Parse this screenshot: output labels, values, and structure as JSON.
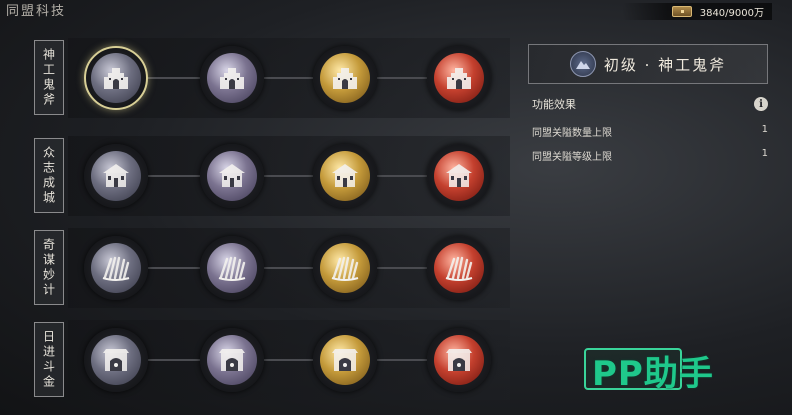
{
  "header": {
    "title": "同盟科技",
    "currency_value": "3840/9000万",
    "currency_icon": "treasure-chest-icon"
  },
  "rows": [
    {
      "label": "神工鬼斧",
      "icon": "fortress-icon"
    },
    {
      "label": "众志成城",
      "icon": "palace-icon"
    },
    {
      "label": "奇谋妙计",
      "icon": "scrolls-icon"
    },
    {
      "label": "日进斗金",
      "icon": "gate-icon"
    }
  ],
  "tiers": [
    "tier1",
    "tier2",
    "tier3",
    "tier4"
  ],
  "selected": {
    "row": 0,
    "tier": 0
  },
  "panel": {
    "title": "初级 · 神工鬼斧",
    "effect_header": "功能效果",
    "effects": [
      {
        "name": "同盟关隘数量上限",
        "value": "1"
      },
      {
        "name": "同盟关隘等级上限",
        "value": "1"
      }
    ]
  },
  "watermark": "PP助手",
  "colors": {
    "tier1": "#6d6e80",
    "tier2": "#7b7390",
    "tier3": "#c49a3a",
    "tier4": "#c4402e",
    "selected_ring": "#d8cf96",
    "watermark": "#1fc88b"
  }
}
